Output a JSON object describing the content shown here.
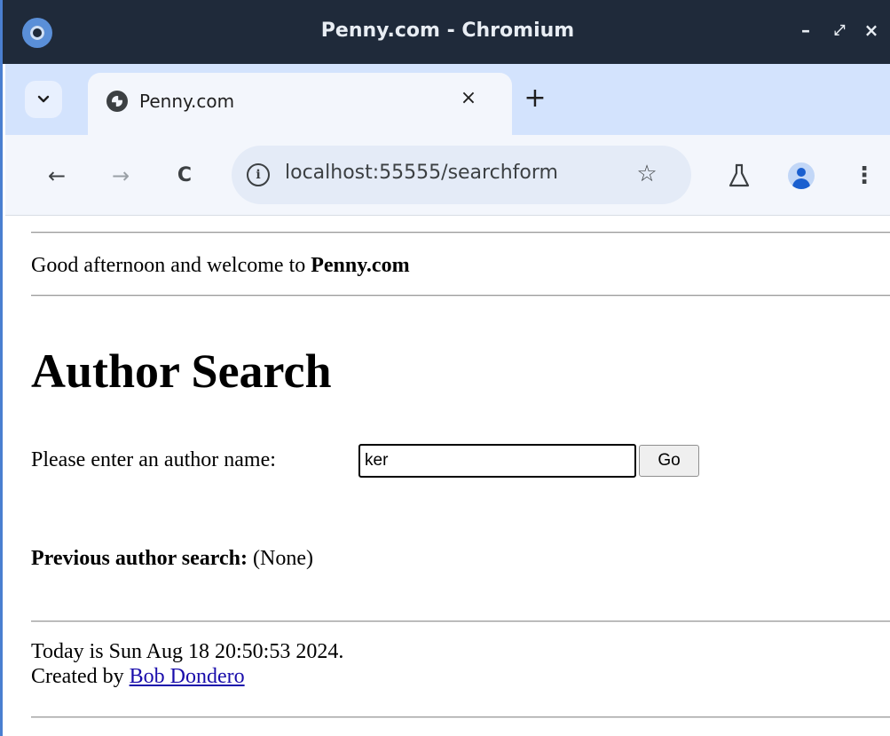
{
  "window": {
    "title": "Penny.com - Chromium",
    "minimize": "–",
    "maximize": "⤢",
    "close": "×"
  },
  "tab": {
    "menu": "⌄",
    "title": "Penny.com",
    "close": "×",
    "new_tab": "+"
  },
  "toolbar": {
    "back": "←",
    "forward": "→",
    "reload": "C",
    "url": "localhost:55555/searchform",
    "info": "i",
    "star": "☆",
    "more": "⋮"
  },
  "page": {
    "greeting_prefix": "Good afternoon and welcome to ",
    "greeting_site": "Penny.com",
    "heading": "Author Search",
    "prompt": "Please enter an author name:",
    "input_value": "ker",
    "go_label": "Go",
    "previous_label": "Previous author search:",
    "previous_value": "(None)",
    "today_text": "Today is Sun Aug 18 20:50:53 2024.",
    "created_by": "Created by ",
    "author_name": "Bob Dondero"
  },
  "icons": {
    "app": "chromium-icon",
    "favicon": "globe-icon",
    "info": "info-icon",
    "star": "star-icon",
    "labs": "flask-icon",
    "profile": "profile-icon",
    "menu": "menu-dots-icon"
  },
  "colors": {
    "titlebar": "#1f2a3a",
    "tabstrip": "#d3e3fd",
    "toolbar": "#f3f6fc",
    "omnibox": "#e4ebf7",
    "link": "#1a0dab",
    "frame_accent": "#4a7fd0"
  }
}
